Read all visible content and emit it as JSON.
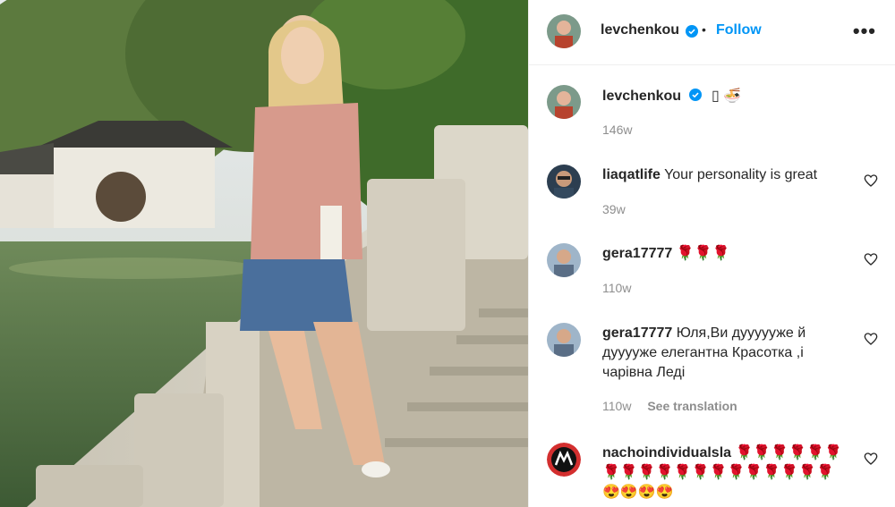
{
  "post": {
    "author": "levchenkou",
    "follow_label": "Follow",
    "separator": "•",
    "more_label": "•••"
  },
  "caption": {
    "username": "levchenkou",
    "text": "▯ 🍜",
    "time": "146w"
  },
  "comments": [
    {
      "username": "liaqatlife",
      "text": "Your personality is great",
      "time": "39w"
    },
    {
      "username": "gera17777",
      "text": "🌹🌹🌹",
      "time": "110w"
    },
    {
      "username": "gera17777",
      "text": "Юля,Ви дуууууже й дууууже елегантна Красотка ,і чарівна Леді",
      "time": "110w",
      "translate": "See translation"
    },
    {
      "username": "nachoindividualsla",
      "text": "🌹🌹🌹🌹🌹🌹🌹🌹🌹🌹🌹🌹🌹🌹🌹🌹🌹🌹🌹😍😍😍😍",
      "time": ""
    }
  ],
  "colors": {
    "accent": "#0095f6",
    "text": "#262626",
    "muted": "#8e8e8e",
    "verified": "#0095f6"
  }
}
